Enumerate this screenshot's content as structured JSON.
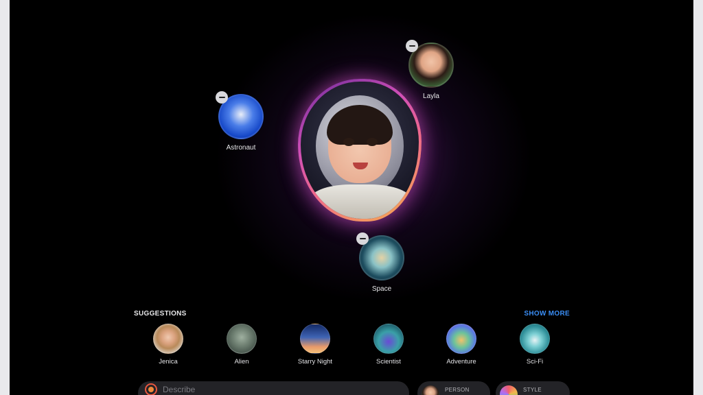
{
  "concepts": [
    {
      "label": "Astronaut",
      "icon": "astronaut-helmet-icon"
    },
    {
      "label": "Layla",
      "icon": "person-photo"
    },
    {
      "label": "Space",
      "icon": "planet-icon"
    }
  ],
  "main_image": {
    "subject": "astronaut-portrait"
  },
  "suggestions": {
    "title": "SUGGESTIONS",
    "show_more": "SHOW MORE",
    "items": [
      {
        "label": "Jenica"
      },
      {
        "label": "Alien"
      },
      {
        "label": "Starry Night"
      },
      {
        "label": "Scientist"
      },
      {
        "label": "Adventure"
      },
      {
        "label": "Sci-Fi"
      }
    ]
  },
  "bottom_bar": {
    "describe_placeholder": "Describe",
    "person_label": "PERSON",
    "style_label": "STYLE"
  },
  "colors": {
    "accent_blue": "#3a8ef6",
    "glow_pink": "#d04fb6",
    "glow_orange": "#f5b04a"
  }
}
